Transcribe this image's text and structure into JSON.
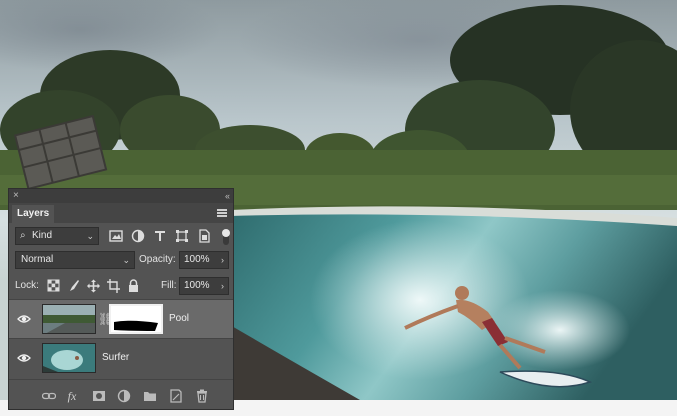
{
  "panel": {
    "close_glyph": "×",
    "collapse_glyph": "‹‹",
    "tab_label": "Layers",
    "filter": {
      "search_glyph": "⌕",
      "kind_label": "Kind"
    },
    "blend_mode": "Normal",
    "opacity_label": "Opacity:",
    "opacity_value": "100%",
    "lock_label": "Lock:",
    "fill_label": "Fill:",
    "fill_value": "100%",
    "layers": [
      {
        "name": "Pool",
        "visible": true,
        "selected": true,
        "has_mask": true
      },
      {
        "name": "Surfer",
        "visible": true,
        "selected": false,
        "has_mask": false
      }
    ],
    "filter_icons": [
      "pixel-layer-filter-icon",
      "adjustment-layer-filter-icon",
      "type-layer-filter-icon",
      "shape-layer-filter-icon",
      "smart-object-filter-icon"
    ],
    "lock_icons": [
      "lock-transparent-pixels-icon",
      "lock-image-pixels-icon",
      "lock-position-icon",
      "lock-artboard-icon",
      "lock-all-icon"
    ],
    "bottom_icons": [
      "link-layers-icon",
      "fx-icon",
      "add-mask-icon",
      "adjustment-layer-icon",
      "new-group-icon",
      "new-layer-icon",
      "trash-icon"
    ],
    "fx_label": "fx"
  }
}
